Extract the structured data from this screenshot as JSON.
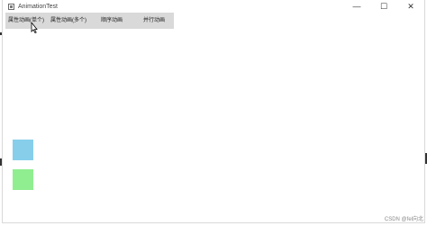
{
  "window": {
    "title": "AnimationTest",
    "controls": {
      "minimize": "—",
      "maximize": "☐",
      "close": "✕"
    }
  },
  "toolbar": {
    "buttons": [
      "属性动画(单个)",
      "属性动画(多个)",
      "顺序动画",
      "并行动画"
    ]
  },
  "boxes": [
    {
      "color": "#87ceeb"
    },
    {
      "color": "#90ee90"
    }
  ],
  "watermark": "CSDN @fel向北"
}
